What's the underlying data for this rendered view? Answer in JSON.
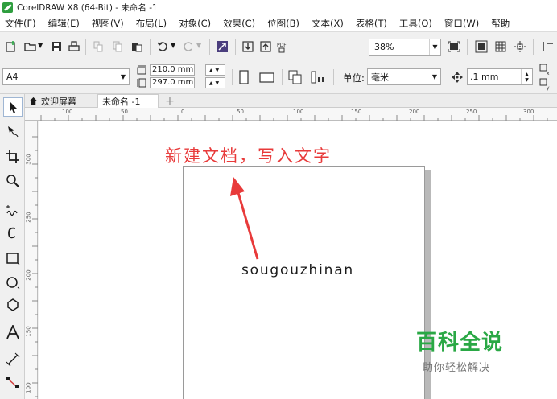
{
  "window": {
    "title": "CorelDRAW X8 (64-Bit) - 未命名 -1"
  },
  "menu": [
    "文件(F)",
    "编辑(E)",
    "视图(V)",
    "布局(L)",
    "对象(C)",
    "效果(C)",
    "位图(B)",
    "文本(X)",
    "表格(T)",
    "工具(O)",
    "窗口(W)",
    "帮助"
  ],
  "toolbar": {
    "zoom_value": "38%"
  },
  "property_bar": {
    "page_size": "A4",
    "width": "210.0 mm",
    "height": "297.0 mm",
    "unit_label": "单位:",
    "unit_value": "毫米",
    "nudge_value": ".1 mm"
  },
  "tabs": {
    "home": "欢迎屏幕",
    "document": "未命名 -1",
    "add": "+"
  },
  "ruler": {
    "h_labels": [
      "100",
      "50",
      "0",
      "50",
      "100",
      "150",
      "200",
      "250",
      "300"
    ],
    "v_labels": [
      "300",
      "250",
      "200",
      "150",
      "100"
    ]
  },
  "canvas": {
    "annotation": "新建文档，写入文字",
    "page_text": "sougouzhinan",
    "annotation_color": "#e83a3a"
  },
  "watermark": {
    "logo": "百科全说",
    "sub": "助你轻松解决",
    "color": "#2aa845"
  }
}
